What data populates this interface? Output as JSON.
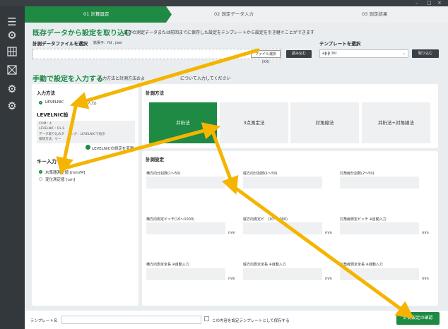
{
  "window": {
    "minimize": "–",
    "restore": "□",
    "close": "×"
  },
  "sidebar": {
    "icons": [
      "menu-icon",
      "settings-icon",
      "grid-icon",
      "crosshair-icon",
      "settings-icon",
      "settings-icon"
    ]
  },
  "steps": [
    "01 計算設定",
    "02 測定データ入力",
    "03 測定結果"
  ],
  "existing": {
    "title": "既存データから設定を取り込む",
    "desc": "既存の測定データまたは前回までに保存した設定をテンプレートから設定を引き継ぐことができます",
    "file_label": "計測データファイルを選択",
    "ext": "拡張子：fid , json",
    "file_select_btn": "ファイル選択(XX)",
    "load_btn": "読み込む",
    "template_label": "テンプレートを選択",
    "template_value": "app.ini",
    "template_load_btn": "取り込む"
  },
  "manual": {
    "title": "手動で設定を入力する",
    "desc": "入力方法と計測方法およ",
    "desc2": "について入力してください"
  },
  "input_method": {
    "title": "入力方法",
    "option": "LEVELNIC",
    "option2": "ー入力)",
    "levelnic_title": "LEVELNIC設",
    "info": [
      "COM : 4",
      "LEVELNIC : DL-S",
      "データ取り込みタ　ミング：LEVELNICで指示",
      "接続方法：ケー"
    ],
    "levelnic_change": "LEVELNICの設定を変更",
    "key_title": "キー入力",
    "key_opt1": "水準器測定値 [mm/M]",
    "key_opt2": "変位測定値 [um]"
  },
  "measure_method": {
    "title": "計測方法",
    "options": [
      "井桁法",
      "3点測定法",
      "対角線法",
      "井桁法+対角線法"
    ]
  },
  "measure_settings": {
    "title": "計測設定",
    "fields": [
      {
        "label": "横方向分割数(1〜50)",
        "unit": ""
      },
      {
        "label": "縦方向分割数(1〜50)",
        "unit": ""
      },
      {
        "label": "対角線分割数(2〜50)",
        "unit": ""
      },
      {
        "label": "横方向測定ピッチ(10〜1000)",
        "unit": "mm"
      },
      {
        "label": "縦方向測定ピ　(10〜1000)",
        "unit": "mm"
      },
      {
        "label": "対角線測定ピッチ ※自動入力",
        "unit": "mm"
      },
      {
        "label": "横方向測定全長 ※自動入力",
        "unit": "mm"
      },
      {
        "label": "縦方向測定全長 ※自動入力",
        "unit": "mm"
      },
      {
        "label": "対角線測定全長 ※自動入力",
        "unit": "mm"
      }
    ]
  },
  "bottom": {
    "template_name_label": "テンプレート名",
    "save_checkbox_label": "この内容を設定テンプレートとして保存する",
    "confirm_btn": "計測設定の確認"
  },
  "colors": {
    "accent": "#1e8a44",
    "sidebar": "#33383d",
    "arrow": "#f5b400"
  }
}
